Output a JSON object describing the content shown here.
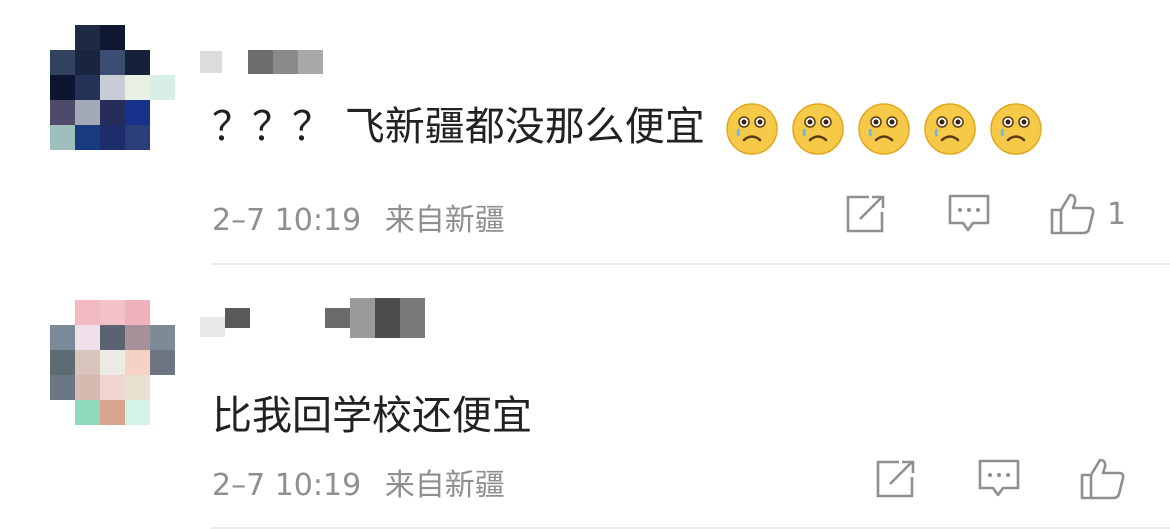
{
  "comments": [
    {
      "text": "？？？ 飞新疆都没那么便宜",
      "emoji_count": 5,
      "emoji_icon": "crying-face-emoji",
      "timestamp": "2–7 10:19",
      "source": "来自新疆",
      "like_count": "1"
    },
    {
      "text": "比我回学校还便宜",
      "timestamp": "2–7 10:19",
      "source": "来自新疆",
      "like_count": ""
    }
  ],
  "icons": {
    "share": "share-icon",
    "reply": "comment-icon",
    "like": "thumbs-up-icon"
  },
  "colors": {
    "text": "#222222",
    "meta": "#8f8f8f",
    "divider": "#ececec",
    "emoji_face": "#f7c948"
  }
}
